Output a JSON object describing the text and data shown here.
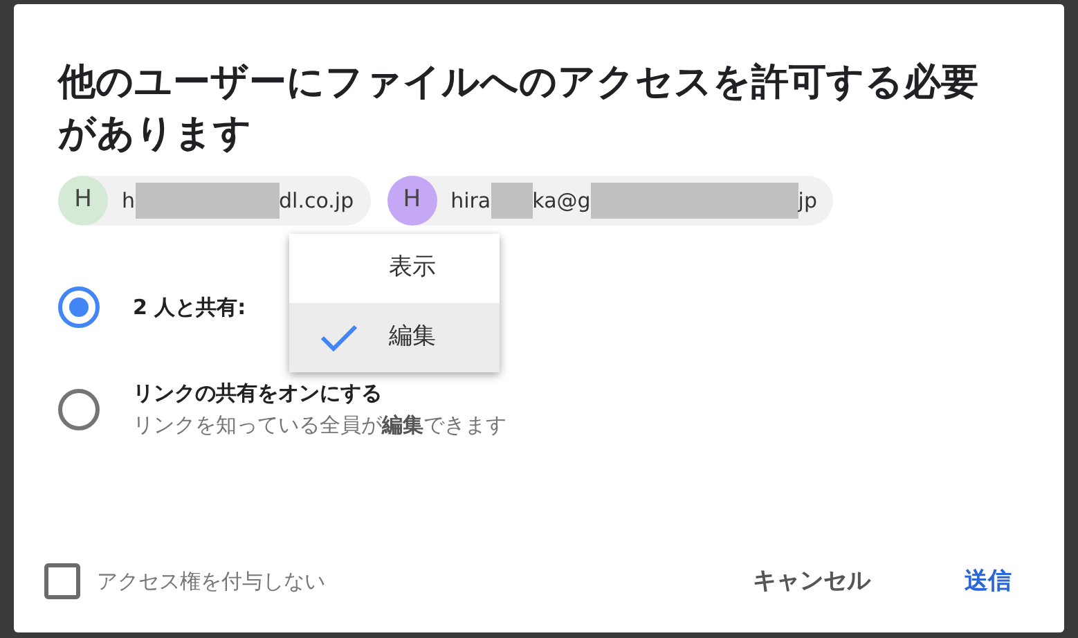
{
  "dialog": {
    "title": "他のユーザーにファイルへのアクセスを許可する必要があります",
    "recipients": [
      {
        "avatar": "H",
        "color": "#d4ead6",
        "parts": [
          {
            "kind": "text",
            "text": "h"
          },
          {
            "kind": "redacted"
          },
          {
            "kind": "text",
            "text": "dl.co.jp"
          }
        ]
      },
      {
        "avatar": "H",
        "color": "#c5a8f5",
        "parts": [
          {
            "kind": "text",
            "text": "hira"
          },
          {
            "kind": "redacted"
          },
          {
            "kind": "text",
            "text": "ka@g"
          },
          {
            "kind": "redacted"
          },
          {
            "kind": "text",
            "text": "jp"
          }
        ]
      }
    ],
    "options": [
      {
        "label": "2 人と共有:",
        "selected": true
      },
      {
        "label": "リンクの共有をオンにする",
        "description": "リンクを知っている全員が**編集**できます",
        "selected": false
      }
    ],
    "role_menu": [
      {
        "label": "表示",
        "selected": false
      },
      {
        "label": "編集",
        "selected": true
      }
    ],
    "no_access_checkbox": {
      "label": "アクセス権を付与しない",
      "checked": false
    },
    "buttons": [
      {
        "label": "キャンセル",
        "kind": "secondary"
      },
      {
        "label": "送信",
        "kind": "primary"
      }
    ]
  }
}
